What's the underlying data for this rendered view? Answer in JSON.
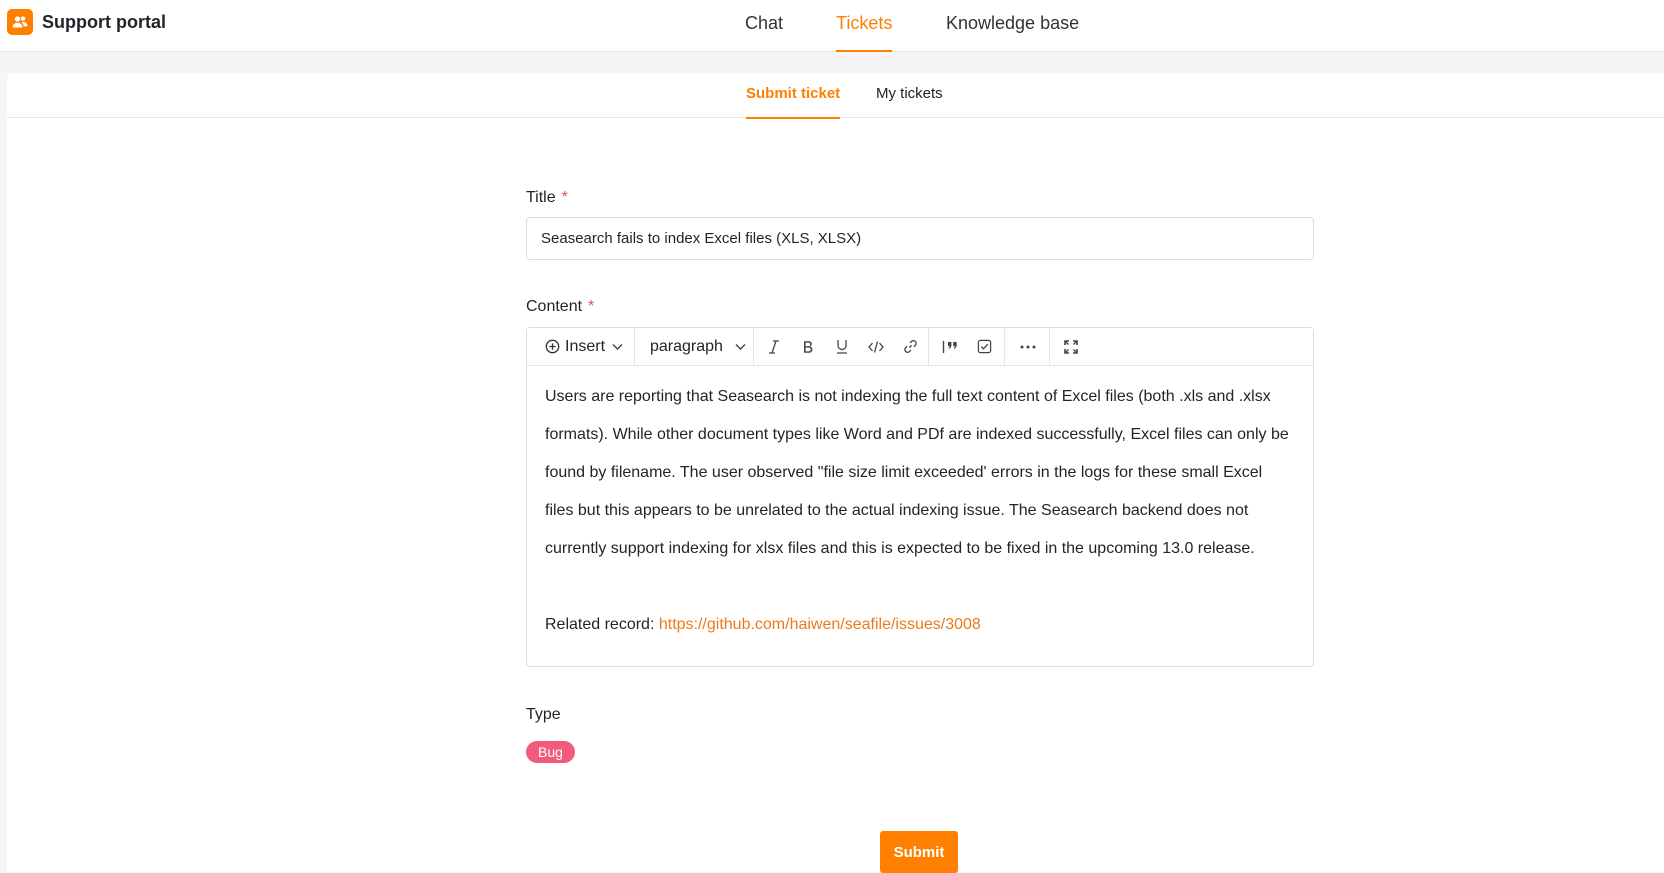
{
  "app": {
    "title": "Support portal",
    "logo_icon": "people-icon",
    "accent_color": "#ff8000"
  },
  "nav": {
    "items": [
      {
        "label": "Chat",
        "active": false
      },
      {
        "label": "Tickets",
        "active": true
      },
      {
        "label": "Knowledge base",
        "active": false
      }
    ]
  },
  "subtabs": {
    "items": [
      {
        "label": "Submit ticket",
        "active": true
      },
      {
        "label": "My tickets",
        "active": false
      }
    ]
  },
  "form": {
    "title_label": "Title",
    "title_value": "Seasearch fails to index Excel files (XLS, XLSX)",
    "content_label": "Content",
    "required_mark": "*",
    "toolbar": {
      "insert_label": "Insert",
      "block_type": "paragraph",
      "icons": [
        "plus-circle-icon",
        "chevron-down-icon",
        "italic-icon",
        "bold-icon",
        "underline-icon",
        "code-icon",
        "link-icon",
        "blockquote-icon",
        "checklist-icon",
        "more-icon",
        "fullscreen-icon"
      ]
    },
    "content": {
      "paragraph": "Users are reporting that Seasearch is not indexing the full text content of Excel files (both .xls and .xlsx formats). While other document types like Word and PDf are indexed successfully, Excel files can only be found by filename. The user observed \"file size limit exceeded' errors in the logs for these small Excel files but this appears to be unrelated to the actual indexing issue. The Seasearch backend does not currently support indexing for xlsx files and this is expected to be fixed in the upcoming 13.0 release.",
      "related_label": "Related record: ",
      "related_link": "https://github.com/haiwen/seafile/issues/3008"
    },
    "type_label": "Type",
    "type_value": "Bug",
    "type_color": "#f25b7a",
    "submit_label": "Submit"
  }
}
